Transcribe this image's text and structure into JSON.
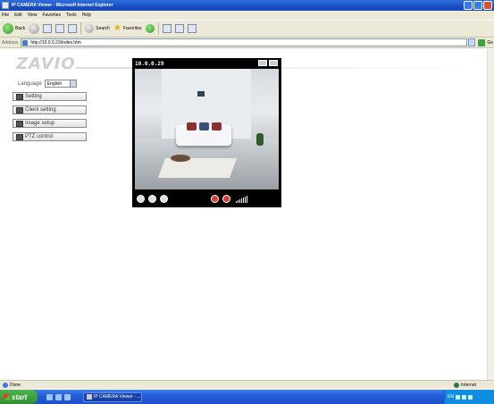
{
  "window": {
    "title": "IP CAMERA Viewer - Microsoft Internet Explorer"
  },
  "menu": [
    "File",
    "Edit",
    "View",
    "Favorites",
    "Tools",
    "Help"
  ],
  "toolbar": {
    "back_label": "Back",
    "search_label": "Search",
    "favorites_label": "Favorites"
  },
  "address": {
    "label": "Address",
    "url": "http://10.0.0.23/index.htm",
    "go_label": "Go"
  },
  "page": {
    "logo": "ZAVIO",
    "language_label": "Language",
    "language_value": "English",
    "nav": [
      {
        "label": "Setting",
        "icon": "setting-icon"
      },
      {
        "label": "Client setting",
        "icon": "client-icon"
      },
      {
        "label": "Image setup",
        "icon": "image-icon"
      },
      {
        "label": "PTZ control",
        "icon": "ptz-icon"
      }
    ]
  },
  "camera": {
    "ip": "10.0.0.29"
  },
  "status": {
    "text": "Done",
    "zone": "Internet"
  },
  "taskbar": {
    "start_label": "start",
    "task_item": "IP CAMERA Viewer - ...",
    "tray_text": "EN"
  }
}
